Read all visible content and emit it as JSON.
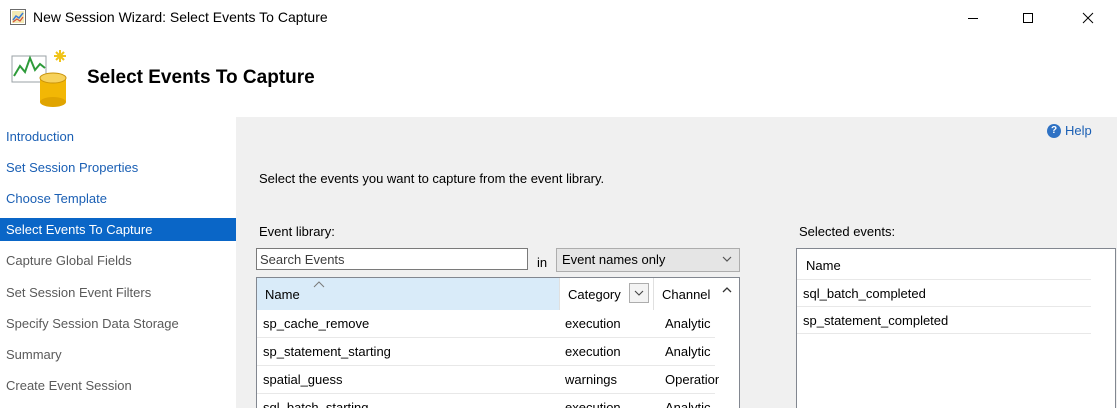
{
  "window": {
    "title": "New Session Wizard: Select Events To Capture",
    "minimize_glyph": "—",
    "maximize_glyph": "☐",
    "close_glyph": "✕"
  },
  "header": {
    "title": "Select Events To Capture",
    "icon": "event-chart-icon"
  },
  "sidebar": {
    "items": [
      {
        "label": "Introduction",
        "state": "link"
      },
      {
        "label": "Set Session Properties",
        "state": "link"
      },
      {
        "label": "Choose Template",
        "state": "link"
      },
      {
        "label": "Select Events To Capture",
        "state": "active"
      },
      {
        "label": "Capture Global Fields",
        "state": "disabled"
      },
      {
        "label": "Set Session Event Filters",
        "state": "disabled"
      },
      {
        "label": "Specify Session Data Storage",
        "state": "disabled"
      },
      {
        "label": "Summary",
        "state": "disabled"
      },
      {
        "label": "Create Event Session",
        "state": "disabled"
      }
    ]
  },
  "main": {
    "help_label": "Help",
    "instruction": "Select the events you want to capture from the event library.",
    "event_library_label": "Event library:",
    "search_placeholder": "Search Events",
    "in_label": "in",
    "scope_selected": "Event names only",
    "grid": {
      "columns": [
        "Name",
        "Category",
        "Channel"
      ],
      "rows": [
        [
          "sp_cache_remove",
          "execution",
          "Analytic"
        ],
        [
          "sp_statement_starting",
          "execution",
          "Analytic"
        ],
        [
          "spatial_guess",
          "warnings",
          "Operation"
        ],
        [
          "sql_batch_starting",
          "execution",
          "Analytic"
        ]
      ]
    },
    "selected_events_label": "Selected events:",
    "selected_header": "Name",
    "selected_events": [
      "sql_batch_completed",
      "sp_statement_completed"
    ]
  },
  "colors": {
    "accent": "#0a66c7",
    "link": "#1a5fb4",
    "panel_bg": "#f0f0f0",
    "sort_header_bg": "#d9ebf9"
  }
}
